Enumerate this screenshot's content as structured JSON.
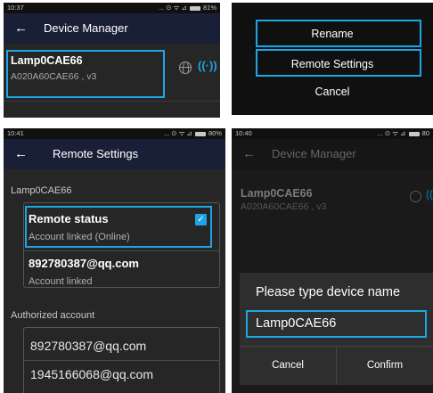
{
  "accent_color": "#1fa4e6",
  "panel1": {
    "status": {
      "time": "10:37",
      "icons": "... ⊙ ᯤ ⊿",
      "battery": "81%"
    },
    "appbar": {
      "back": "←",
      "title": "Device Manager"
    },
    "device": {
      "name": "Lamp0CAE66",
      "sub": "A020A60CAE66 , v3",
      "icons": [
        "globe-icon",
        "signal-icon"
      ],
      "signal_glyph": "((·))"
    }
  },
  "panel2": {
    "menu": [
      "Rename",
      "Remote Settings",
      "Cancel"
    ]
  },
  "panel3": {
    "status": {
      "time": "10:41",
      "icons": "... ⊙ ᯤ ⊿",
      "battery": "80%"
    },
    "appbar": {
      "back": "←",
      "title": "Remote Settings"
    },
    "device_label": "Lamp0CAE66",
    "remote_status": {
      "title": "Remote status",
      "sub": "Account linked (Online)",
      "checked": true,
      "check_glyph": "✓"
    },
    "linked_account": {
      "email": "892780387@qq.com",
      "sub": "Account linked"
    },
    "authorized_label": "Authorized account",
    "authorized_accounts": [
      "892780387@qq.com",
      "1945166068@qq.com"
    ]
  },
  "panel4": {
    "status": {
      "time": "10:40",
      "icons": "... ⊙ ᯤ ⊿",
      "battery": "80"
    },
    "appbar": {
      "back": "←",
      "title": "Device Manager"
    },
    "device": {
      "name": "Lamp0CAE66",
      "sub": "A020A60CAE66 , v3",
      "signal_glyph": "((·"
    },
    "dialog": {
      "title": "Please type device name",
      "input_value": "Lamp0CAE66",
      "cancel": "Cancel",
      "confirm": "Confirm"
    }
  }
}
